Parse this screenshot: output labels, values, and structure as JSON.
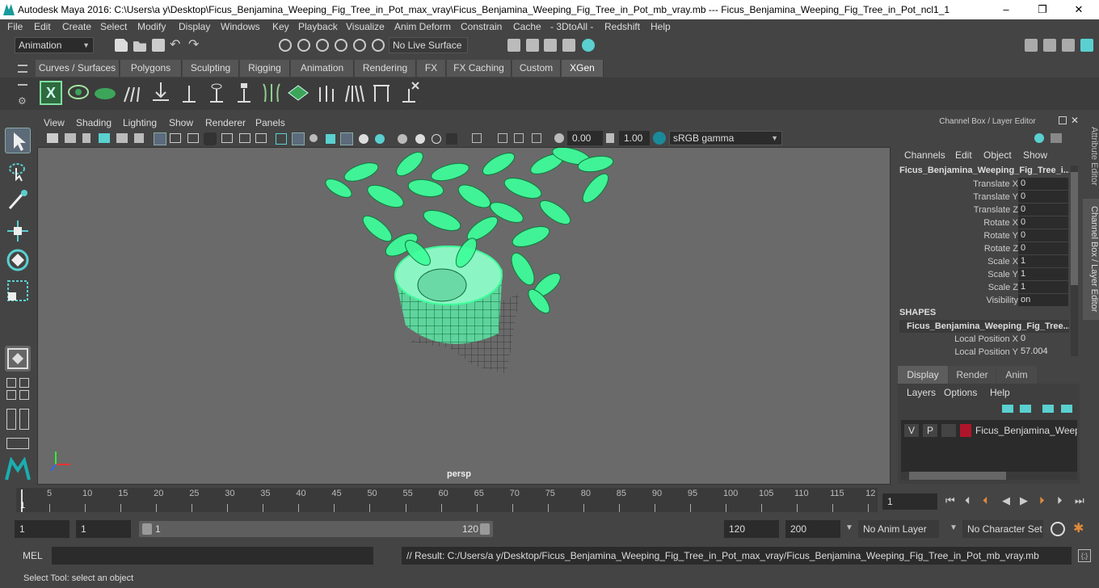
{
  "title": "Autodesk Maya 2016: C:\\Users\\a y\\Desktop\\Ficus_Benjamina_Weeping_Fig_Tree_in_Pot_max_vray\\Ficus_Benjamina_Weeping_Fig_Tree_in_Pot_mb_vray.mb   ---   Ficus_Benjamina_Weeping_Fig_Tree_in_Pot_ncl1_1",
  "window_controls": {
    "minimize": "–",
    "maximize": "❐",
    "close": "✕"
  },
  "menu": [
    "File",
    "Edit",
    "Create",
    "Select",
    "Modify",
    "Display",
    "Windows",
    "Key",
    "Playback",
    "Visualize",
    "Anim Deform",
    "Constrain",
    "Cache",
    "- 3DtoAll -",
    "Redshift",
    "Help"
  ],
  "toolbar": {
    "mode": "Animation",
    "live_surface": "No Live Surface"
  },
  "shelf_tabs": [
    "Curves / Surfaces",
    "Polygons",
    "Sculpting",
    "Rigging",
    "Animation",
    "Rendering",
    "FX",
    "FX Caching",
    "Custom",
    "XGen"
  ],
  "active_shelf": "XGen",
  "panel_menu": [
    "View",
    "Shading",
    "Lighting",
    "Show",
    "Renderer",
    "Panels"
  ],
  "panel_toolbar": {
    "exposure": "0.00",
    "gamma": "1.00",
    "color_space": "sRGB gamma"
  },
  "viewport": {
    "camera": "persp"
  },
  "channel_box": {
    "header": "Channel Box / Layer Editor",
    "menu": [
      "Channels",
      "Edit",
      "Object",
      "Show"
    ],
    "object": "Ficus_Benjamina_Weeping_Fig_Tree_i...",
    "channels": [
      {
        "label": "Translate X",
        "value": "0"
      },
      {
        "label": "Translate Y",
        "value": "0"
      },
      {
        "label": "Translate Z",
        "value": "0"
      },
      {
        "label": "Rotate X",
        "value": "0"
      },
      {
        "label": "Rotate Y",
        "value": "0"
      },
      {
        "label": "Rotate Z",
        "value": "0"
      },
      {
        "label": "Scale X",
        "value": "1"
      },
      {
        "label": "Scale Y",
        "value": "1"
      },
      {
        "label": "Scale Z",
        "value": "1"
      },
      {
        "label": "Visibility",
        "value": "on"
      }
    ],
    "shapes_label": "SHAPES",
    "shape_name": "Ficus_Benjamina_Weeping_Fig_Tree...",
    "shape_channels": [
      {
        "label": "Local Position X",
        "value": "0"
      },
      {
        "label": "Local Position Y",
        "value": "57.004"
      }
    ]
  },
  "side_tabs": {
    "attribute_editor": "Attribute Editor",
    "channel_box": "Channel Box / Layer Editor"
  },
  "layer_editor": {
    "tabs": [
      "Display",
      "Render",
      "Anim"
    ],
    "menu": [
      "Layers",
      "Options",
      "Help"
    ],
    "layer": {
      "v": "V",
      "p": "P",
      "name": "Ficus_Benjamina_Weepir",
      "color": "#b0142a"
    }
  },
  "timeline": {
    "ticks": [
      "5",
      "10",
      "15",
      "20",
      "25",
      "30",
      "35",
      "40",
      "45",
      "50",
      "55",
      "60",
      "65",
      "70",
      "75",
      "80",
      "85",
      "90",
      "95",
      "100",
      "105",
      "110",
      "115",
      "12"
    ],
    "start_marker": "1",
    "current_frame": "1"
  },
  "range": {
    "start": "1",
    "playback_start": "1",
    "range_start": "1",
    "range_end": "120",
    "playback_end": "120",
    "end": "200",
    "anim_layer": "No Anim Layer",
    "character_set": "No Character Set"
  },
  "mel": {
    "label": "MEL",
    "result": "// Result: C:/Users/a y/Desktop/Ficus_Benjamina_Weeping_Fig_Tree_in_Pot_max_vray/Ficus_Benjamina_Weeping_Fig_Tree_in_Pot_mb_vray.mb"
  },
  "help_line": "Select Tool: select an object",
  "colors": {
    "accent": "#5ad0d0",
    "wireframe": "#3dff9a",
    "active_tab": "#5d5d5d"
  }
}
